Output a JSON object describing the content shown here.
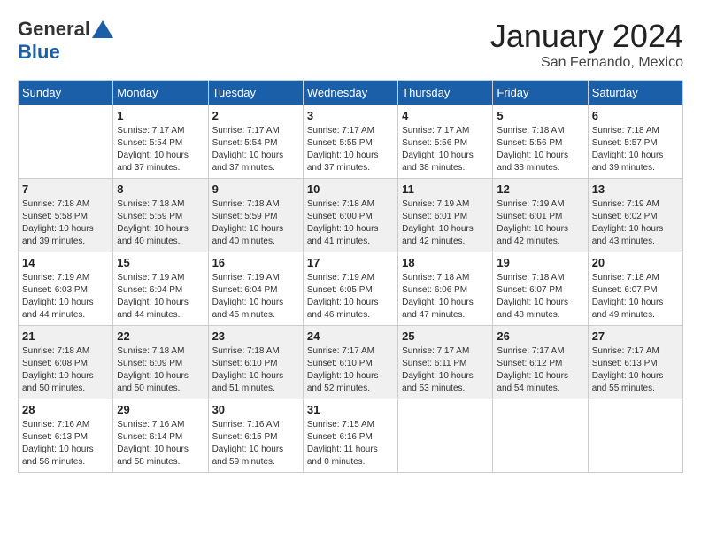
{
  "header": {
    "logo": {
      "general": "General",
      "blue": "Blue"
    },
    "title": "January 2024",
    "location": "San Fernando, Mexico"
  },
  "weekdays": [
    "Sunday",
    "Monday",
    "Tuesday",
    "Wednesday",
    "Thursday",
    "Friday",
    "Saturday"
  ],
  "weeks": [
    [
      {
        "day": "",
        "info": ""
      },
      {
        "day": "1",
        "info": "Sunrise: 7:17 AM\nSunset: 5:54 PM\nDaylight: 10 hours\nand 37 minutes."
      },
      {
        "day": "2",
        "info": "Sunrise: 7:17 AM\nSunset: 5:54 PM\nDaylight: 10 hours\nand 37 minutes."
      },
      {
        "day": "3",
        "info": "Sunrise: 7:17 AM\nSunset: 5:55 PM\nDaylight: 10 hours\nand 37 minutes."
      },
      {
        "day": "4",
        "info": "Sunrise: 7:17 AM\nSunset: 5:56 PM\nDaylight: 10 hours\nand 38 minutes."
      },
      {
        "day": "5",
        "info": "Sunrise: 7:18 AM\nSunset: 5:56 PM\nDaylight: 10 hours\nand 38 minutes."
      },
      {
        "day": "6",
        "info": "Sunrise: 7:18 AM\nSunset: 5:57 PM\nDaylight: 10 hours\nand 39 minutes."
      }
    ],
    [
      {
        "day": "7",
        "info": "Sunrise: 7:18 AM\nSunset: 5:58 PM\nDaylight: 10 hours\nand 39 minutes."
      },
      {
        "day": "8",
        "info": "Sunrise: 7:18 AM\nSunset: 5:59 PM\nDaylight: 10 hours\nand 40 minutes."
      },
      {
        "day": "9",
        "info": "Sunrise: 7:18 AM\nSunset: 5:59 PM\nDaylight: 10 hours\nand 40 minutes."
      },
      {
        "day": "10",
        "info": "Sunrise: 7:18 AM\nSunset: 6:00 PM\nDaylight: 10 hours\nand 41 minutes."
      },
      {
        "day": "11",
        "info": "Sunrise: 7:19 AM\nSunset: 6:01 PM\nDaylight: 10 hours\nand 42 minutes."
      },
      {
        "day": "12",
        "info": "Sunrise: 7:19 AM\nSunset: 6:01 PM\nDaylight: 10 hours\nand 42 minutes."
      },
      {
        "day": "13",
        "info": "Sunrise: 7:19 AM\nSunset: 6:02 PM\nDaylight: 10 hours\nand 43 minutes."
      }
    ],
    [
      {
        "day": "14",
        "info": "Sunrise: 7:19 AM\nSunset: 6:03 PM\nDaylight: 10 hours\nand 44 minutes."
      },
      {
        "day": "15",
        "info": "Sunrise: 7:19 AM\nSunset: 6:04 PM\nDaylight: 10 hours\nand 44 minutes."
      },
      {
        "day": "16",
        "info": "Sunrise: 7:19 AM\nSunset: 6:04 PM\nDaylight: 10 hours\nand 45 minutes."
      },
      {
        "day": "17",
        "info": "Sunrise: 7:19 AM\nSunset: 6:05 PM\nDaylight: 10 hours\nand 46 minutes."
      },
      {
        "day": "18",
        "info": "Sunrise: 7:18 AM\nSunset: 6:06 PM\nDaylight: 10 hours\nand 47 minutes."
      },
      {
        "day": "19",
        "info": "Sunrise: 7:18 AM\nSunset: 6:07 PM\nDaylight: 10 hours\nand 48 minutes."
      },
      {
        "day": "20",
        "info": "Sunrise: 7:18 AM\nSunset: 6:07 PM\nDaylight: 10 hours\nand 49 minutes."
      }
    ],
    [
      {
        "day": "21",
        "info": "Sunrise: 7:18 AM\nSunset: 6:08 PM\nDaylight: 10 hours\nand 50 minutes."
      },
      {
        "day": "22",
        "info": "Sunrise: 7:18 AM\nSunset: 6:09 PM\nDaylight: 10 hours\nand 50 minutes."
      },
      {
        "day": "23",
        "info": "Sunrise: 7:18 AM\nSunset: 6:10 PM\nDaylight: 10 hours\nand 51 minutes."
      },
      {
        "day": "24",
        "info": "Sunrise: 7:17 AM\nSunset: 6:10 PM\nDaylight: 10 hours\nand 52 minutes."
      },
      {
        "day": "25",
        "info": "Sunrise: 7:17 AM\nSunset: 6:11 PM\nDaylight: 10 hours\nand 53 minutes."
      },
      {
        "day": "26",
        "info": "Sunrise: 7:17 AM\nSunset: 6:12 PM\nDaylight: 10 hours\nand 54 minutes."
      },
      {
        "day": "27",
        "info": "Sunrise: 7:17 AM\nSunset: 6:13 PM\nDaylight: 10 hours\nand 55 minutes."
      }
    ],
    [
      {
        "day": "28",
        "info": "Sunrise: 7:16 AM\nSunset: 6:13 PM\nDaylight: 10 hours\nand 56 minutes."
      },
      {
        "day": "29",
        "info": "Sunrise: 7:16 AM\nSunset: 6:14 PM\nDaylight: 10 hours\nand 58 minutes."
      },
      {
        "day": "30",
        "info": "Sunrise: 7:16 AM\nSunset: 6:15 PM\nDaylight: 10 hours\nand 59 minutes."
      },
      {
        "day": "31",
        "info": "Sunrise: 7:15 AM\nSunset: 6:16 PM\nDaylight: 11 hours\nand 0 minutes."
      },
      {
        "day": "",
        "info": ""
      },
      {
        "day": "",
        "info": ""
      },
      {
        "day": "",
        "info": ""
      }
    ]
  ]
}
